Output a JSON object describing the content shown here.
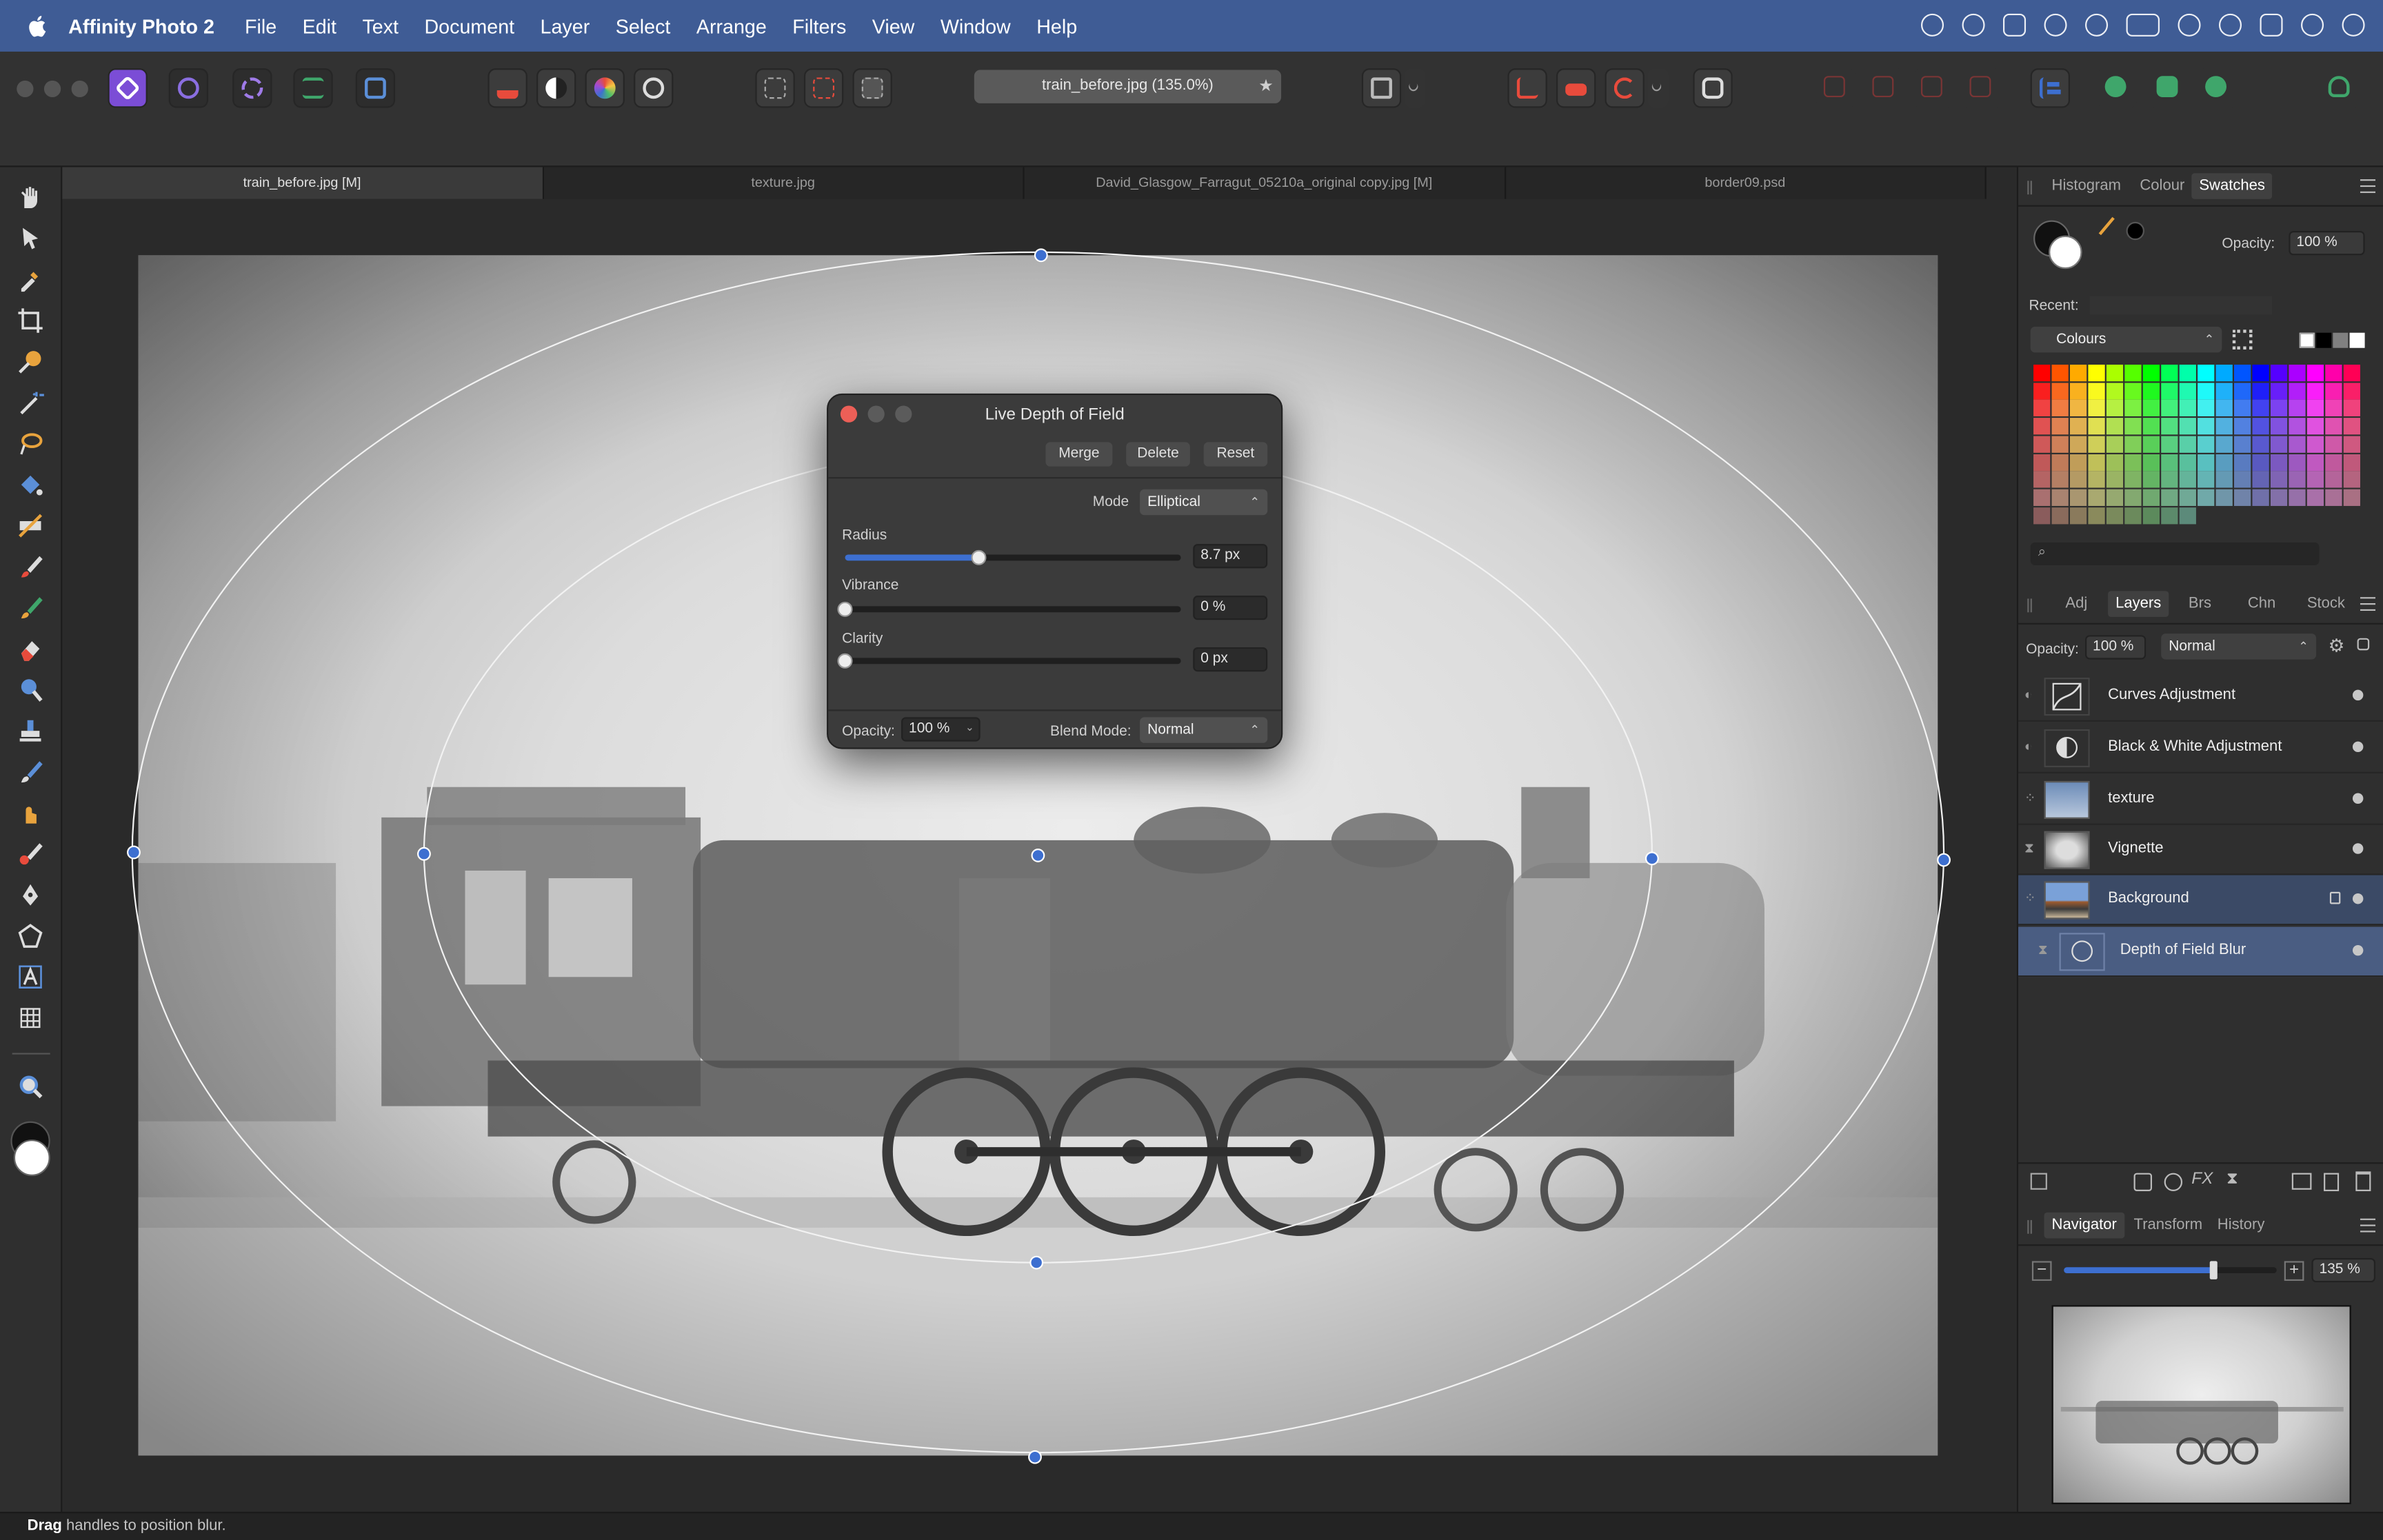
{
  "menubar": {
    "app_name": "Affinity Photo 2",
    "items": [
      "File",
      "Edit",
      "Text",
      "Document",
      "Layer",
      "Select",
      "Arrange",
      "Filters",
      "View",
      "Window",
      "Help"
    ]
  },
  "toolbar": {
    "document_title": "train_before.jpg (135.0%)"
  },
  "document_tabs": [
    "train_before.jpg [M]",
    "texture.jpg",
    "David_Glasgow_Farragut_05210a_original copy.jpg [M]",
    "border09.psd"
  ],
  "dialog": {
    "title": "Live Depth of Field",
    "buttons": {
      "merge": "Merge",
      "delete": "Delete",
      "reset": "Reset"
    },
    "mode_label": "Mode",
    "mode_value": "Elliptical",
    "radius": {
      "label": "Radius",
      "value": "8.7 px",
      "level": 0.4
    },
    "vibrance": {
      "label": "Vibrance",
      "value": "0 %",
      "level": 0
    },
    "clarity": {
      "label": "Clarity",
      "value": "0 px",
      "level": 0
    },
    "opacity_label": "Opacity:",
    "opacity_value": "100 %",
    "blend_label": "Blend Mode:",
    "blend_value": "Normal"
  },
  "swatches_panel": {
    "tabs": [
      "Histogram",
      "Colour",
      "Swatches"
    ],
    "active_tab": "Swatches",
    "opacity_label": "Opacity:",
    "opacity_value": "100 %",
    "recent_label": "Recent:",
    "palette_name": "Colours"
  },
  "layers_panel": {
    "tabs": [
      "Adj",
      "Layers",
      "Brs",
      "Chn",
      "Stock"
    ],
    "active_tab": "Layers",
    "opacity_label": "Opacity:",
    "opacity_value": "100 %",
    "blend_value": "Normal",
    "layers": [
      {
        "name": "Curves Adjustment",
        "icon": "curves-icon"
      },
      {
        "name": "Black & White Adjustment",
        "icon": "black-white-icon"
      },
      {
        "name": "texture",
        "icon": "texture-thumbnail"
      },
      {
        "name": "Vignette",
        "icon": "vignette-thumbnail"
      },
      {
        "name": "Background",
        "icon": "background-thumbnail"
      },
      {
        "name": "Depth of Field Blur",
        "icon": "blur-icon"
      }
    ]
  },
  "navigator_panel": {
    "tabs": [
      "Navigator",
      "Transform",
      "History"
    ],
    "active_tab": "Navigator",
    "zoom_value": "135 %",
    "zoom_level": 0.7
  },
  "statusbar": {
    "bold": "Drag",
    "text": " handles to position blur."
  },
  "colors": {
    "menubar": "#3f5c95",
    "selection": "#4a5d82",
    "accent": "#3d6fd0",
    "close": "#ec5f57"
  }
}
